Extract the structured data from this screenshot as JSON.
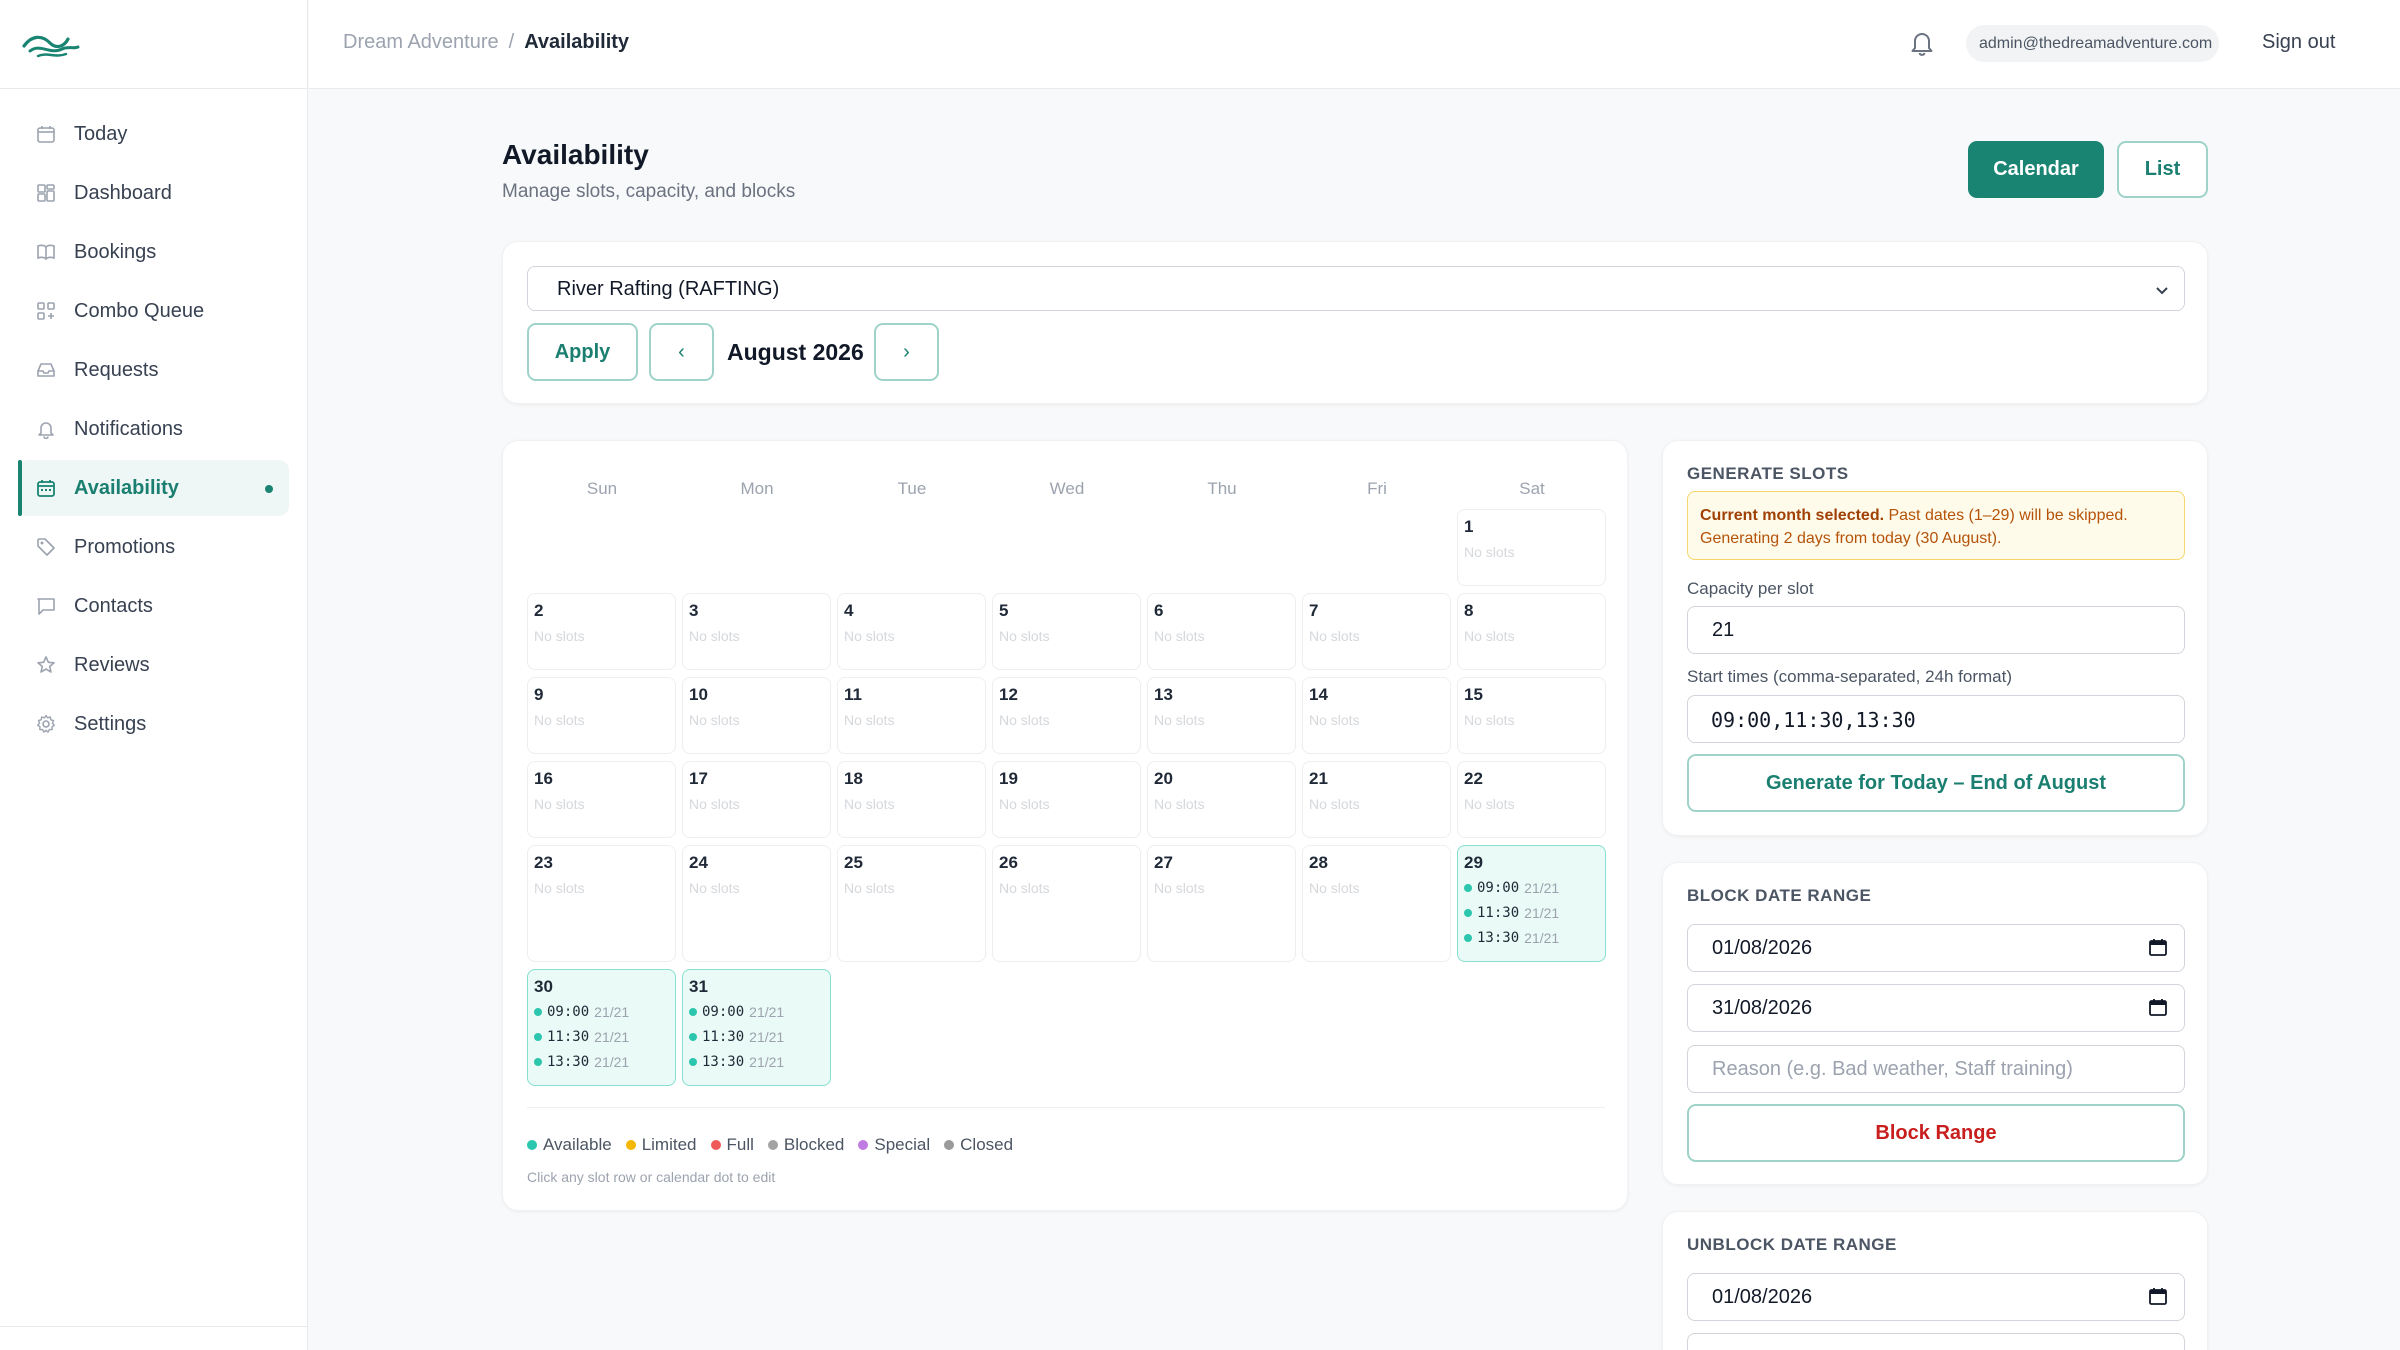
{
  "sidebar": {
    "items": [
      {
        "label": "Today",
        "icon": "calendar-icon"
      },
      {
        "label": "Dashboard",
        "icon": "grid-icon"
      },
      {
        "label": "Bookings",
        "icon": "book-icon"
      },
      {
        "label": "Combo Queue",
        "icon": "queue-icon"
      },
      {
        "label": "Requests",
        "icon": "inbox-icon"
      },
      {
        "label": "Notifications",
        "icon": "bell-icon"
      },
      {
        "label": "Availability",
        "icon": "calendar-icon",
        "active": true
      },
      {
        "label": "Promotions",
        "icon": "tag-icon"
      },
      {
        "label": "Contacts",
        "icon": "chat-icon"
      },
      {
        "label": "Reviews",
        "icon": "star-icon"
      },
      {
        "label": "Settings",
        "icon": "gear-icon"
      }
    ]
  },
  "header": {
    "breadcrumb_root": "Dream Adventure",
    "breadcrumb_sep": "/",
    "breadcrumb_current": "Availability",
    "user_email": "admin@thedreamadventure.com",
    "sign_out": "Sign out"
  },
  "page": {
    "title": "Availability",
    "subtitle": "Manage slots, capacity, and blocks",
    "view_calendar": "Calendar",
    "view_list": "List"
  },
  "filter": {
    "activity": "River Rafting (RAFTING)",
    "apply": "Apply",
    "prev": "‹",
    "next": "›",
    "month": "August 2026"
  },
  "calendar": {
    "weekdays": [
      "Sun",
      "Mon",
      "Tue",
      "Wed",
      "Thu",
      "Fri",
      "Sat"
    ],
    "first_weekday": 6,
    "days_in_month": 31,
    "no_slots_label": "No slots",
    "days_with_slots": {
      "29": [
        {
          "time": "09:00",
          "cap": "21/21"
        },
        {
          "time": "11:30",
          "cap": "21/21"
        },
        {
          "time": "13:30",
          "cap": "21/21"
        }
      ],
      "30": [
        {
          "time": "09:00",
          "cap": "21/21"
        },
        {
          "time": "11:30",
          "cap": "21/21"
        },
        {
          "time": "13:30",
          "cap": "21/21"
        }
      ],
      "31": [
        {
          "time": "09:00",
          "cap": "21/21"
        },
        {
          "time": "11:30",
          "cap": "21/21"
        },
        {
          "time": "13:30",
          "cap": "21/21"
        }
      ]
    },
    "legend": [
      {
        "label": "Available",
        "color": "#2bc6ad"
      },
      {
        "label": "Limited",
        "color": "#f5b800"
      },
      {
        "label": "Full",
        "color": "#ef5b5b"
      },
      {
        "label": "Blocked",
        "color": "#a3a3a3"
      },
      {
        "label": "Special",
        "color": "#c07ce0"
      },
      {
        "label": "Closed",
        "color": "#9a9a9a"
      }
    ],
    "hint": "Click any slot row or calendar dot to edit"
  },
  "generate": {
    "title": "GENERATE SLOTS",
    "notice_bold": "Current month selected.",
    "notice_text": " Past dates (1–29) will be skipped. Generating 2 days from today (30 August).",
    "capacity_label": "Capacity per slot",
    "capacity_value": "21",
    "times_label": "Start times (comma-separated, 24h format)",
    "times_value": "09:00,11:30,13:30",
    "button": "Generate for Today – End of August"
  },
  "block": {
    "title": "BLOCK DATE RANGE",
    "from": "01/08/2026",
    "to": "31/08/2026",
    "reason_placeholder": "Reason (e.g. Bad weather, Staff training)",
    "button": "Block Range"
  },
  "unblock": {
    "title": "UNBLOCK DATE RANGE",
    "from": "01/08/2026"
  },
  "colors": {
    "accent": "#1a8473",
    "danger": "#c81e1e",
    "available": "#2bc6ad"
  }
}
